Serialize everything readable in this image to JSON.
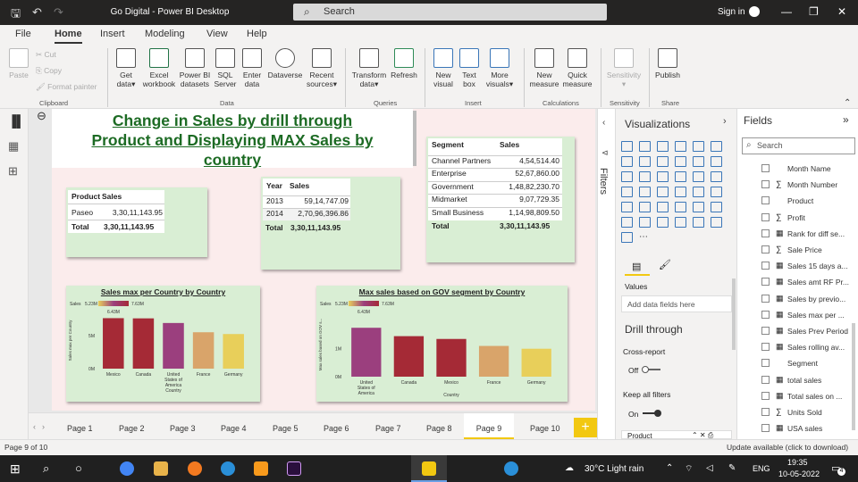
{
  "window": {
    "title": "Go Digital - Power BI Desktop",
    "search_placeholder": "Search",
    "sign_in": "Sign in"
  },
  "menu": {
    "items": [
      "File",
      "Home",
      "Insert",
      "Modeling",
      "View",
      "Help"
    ]
  },
  "ribbon": {
    "clipboard": {
      "paste": "Paste",
      "cut": "Cut",
      "copy": "Copy",
      "format_painter": "Format painter",
      "group": "Clipboard"
    },
    "data": {
      "get_data": [
        "Get",
        "data"
      ],
      "excel": [
        "Excel",
        "workbook"
      ],
      "datasets": [
        "Power BI",
        "datasets"
      ],
      "sql": [
        "SQL",
        "Server"
      ],
      "enter": [
        "Enter",
        "data"
      ],
      "dataverse": "Dataverse",
      "recent": [
        "Recent",
        "sources"
      ],
      "group": "Data"
    },
    "queries": {
      "transform": [
        "Transform",
        "data"
      ],
      "refresh": "Refresh",
      "group": "Queries"
    },
    "insert": {
      "new_visual": [
        "New",
        "visual"
      ],
      "text_box": [
        "Text",
        "box"
      ],
      "more_visuals": [
        "More",
        "visuals"
      ],
      "group": "Insert"
    },
    "calculations": {
      "new_measure": [
        "New",
        "measure"
      ],
      "quick_measure": [
        "Quick",
        "measure"
      ],
      "group": "Calculations"
    },
    "sensitivity": {
      "label": "Sensitivity",
      "group": "Sensitivity"
    },
    "share": {
      "publish": "Publish",
      "group": "Share"
    }
  },
  "report": {
    "title_lines": [
      "Change in Sales by drill through",
      "Product and Displaying MAX Sales by",
      "country"
    ],
    "table1": {
      "headers": [
        "Product",
        "Sales"
      ],
      "rows": [
        [
          "Paseo",
          "3,30,11,143.95"
        ]
      ],
      "total": [
        "Total",
        "3,30,11,143.95"
      ]
    },
    "table2": {
      "headers": [
        "Year",
        "Sales"
      ],
      "rows": [
        [
          "2013",
          "59,14,747.09"
        ],
        [
          "2014",
          "2,70,96,396.86"
        ]
      ],
      "total": [
        "Total",
        "3,30,11,143.95"
      ]
    },
    "table3": {
      "headers": [
        "Segment",
        "Sales"
      ],
      "rows": [
        [
          "Channel Partners",
          "4,54,514.40"
        ],
        [
          "Enterprise",
          "52,67,860.00"
        ],
        [
          "Government",
          "1,48,82,230.70"
        ],
        [
          "Midmarket",
          "9,07,729.35"
        ],
        [
          "Small Business",
          "1,14,98,809.50"
        ]
      ],
      "total": [
        "Total",
        "3,30,11,143.95"
      ]
    }
  },
  "chart_data": [
    {
      "type": "bar",
      "title": "Sales max per Country by Country",
      "legend_label": "Sales",
      "legend_min": "5.23M",
      "legend_max": "7.63M",
      "legend_mid": "6.43M",
      "xlabel": "Country",
      "ylabel": "Sales max per Country",
      "categories": [
        "Mexico",
        "Canada",
        "United States of America",
        "France",
        "Germany"
      ],
      "values": [
        7.63,
        7.6,
        6.9,
        5.5,
        5.23
      ],
      "yticks": [
        "0M",
        "5M"
      ],
      "ylim": [
        0,
        8.5
      ],
      "colors": [
        "#a52a36",
        "#a52a36",
        "#9b3f7e",
        "#d9a46a",
        "#e8cf5a"
      ]
    },
    {
      "type": "bar",
      "title": "Max sales based on GOV segment by Country",
      "legend_label": "Sales",
      "legend_min": "5.23M",
      "legend_max": "7.63M",
      "legend_mid": "6.43M",
      "xlabel": "Country",
      "ylabel": "Max sales based on GOV s...",
      "categories": [
        "United States of America",
        "Canada",
        "Mexico",
        "France",
        "Germany"
      ],
      "values": [
        1.75,
        1.45,
        1.35,
        1.1,
        1.0
      ],
      "yticks": [
        "0M",
        "1M"
      ],
      "ylim": [
        0,
        2.3
      ],
      "colors": [
        "#9b3f7e",
        "#a52a36",
        "#a52a36",
        "#d9a46a",
        "#e8cf5a"
      ]
    }
  ],
  "pages": {
    "tabs": [
      "Page 1",
      "Page 2",
      "Page 3",
      "Page 4",
      "Page 5",
      "Page 6",
      "Page 7",
      "Page 8",
      "Page 9",
      "Page 10"
    ],
    "active": "Page 9",
    "add": "+"
  },
  "filters": {
    "label": "Filters"
  },
  "visualizations": {
    "title": "Visualizations",
    "values_label": "Values",
    "add_fields": "Add data fields here",
    "drill_through": "Drill through",
    "cross_report": "Cross-report",
    "cross_report_state": "Off",
    "keep_filters": "Keep all filters",
    "keep_filters_state": "On",
    "drill_field": "Product"
  },
  "fields": {
    "title": "Fields",
    "search_placeholder": "Search",
    "items": [
      {
        "label": "Month Name",
        "prefix": ""
      },
      {
        "label": "Month Number",
        "prefix": "∑"
      },
      {
        "label": "Product",
        "prefix": ""
      },
      {
        "label": "Profit",
        "prefix": "∑"
      },
      {
        "label": "Rank for diff se...",
        "prefix": "▦"
      },
      {
        "label": "Sale Price",
        "prefix": "∑"
      },
      {
        "label": "Sales 15 days a...",
        "prefix": "▦"
      },
      {
        "label": "Sales amt RF Pr...",
        "prefix": "▦"
      },
      {
        "label": "Sales by previo...",
        "prefix": "▦"
      },
      {
        "label": "Sales max per ...",
        "prefix": "▦"
      },
      {
        "label": "Sales Prev Period",
        "prefix": "▦"
      },
      {
        "label": "Sales rolling av...",
        "prefix": "▦"
      },
      {
        "label": "Segment",
        "prefix": ""
      },
      {
        "label": "total sales",
        "prefix": "▦"
      },
      {
        "label": "Total sales on ...",
        "prefix": "▦"
      },
      {
        "label": "Units Sold",
        "prefix": "∑"
      },
      {
        "label": "USA sales",
        "prefix": "▦"
      }
    ]
  },
  "status": {
    "page": "Page 9 of 10",
    "update": "Update available (click to download)"
  },
  "taskbar": {
    "weather": "30°C  Light rain",
    "lang": "ENG",
    "time": "19:35",
    "date": "10-05-2022",
    "badge": "4"
  }
}
